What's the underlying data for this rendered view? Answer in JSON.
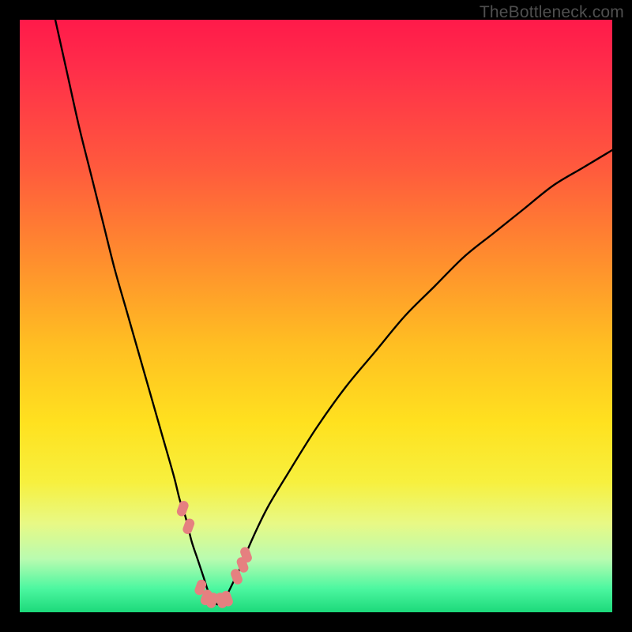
{
  "watermark": "TheBottleneck.com",
  "chart_data": {
    "type": "line",
    "title": "",
    "xlabel": "",
    "ylabel": "",
    "xlim": [
      0,
      100
    ],
    "ylim": [
      0,
      100
    ],
    "grid": false,
    "minimum_x": 33,
    "series": [
      {
        "name": "bottleneck-curve",
        "color": "#000000",
        "x": [
          6,
          8,
          10,
          12,
          14,
          16,
          18,
          20,
          22,
          24,
          26,
          27,
          28,
          29,
          30,
          31,
          32,
          33,
          34,
          35,
          36,
          37,
          38,
          40,
          42,
          45,
          50,
          55,
          60,
          65,
          70,
          75,
          80,
          85,
          90,
          95,
          100
        ],
        "values": [
          100,
          91,
          82,
          74,
          66,
          58,
          51,
          44,
          37,
          30,
          23,
          19,
          16,
          12,
          9,
          6,
          3,
          1.5,
          1.5,
          3,
          5,
          7,
          9.5,
          14,
          18,
          23,
          31,
          38,
          44,
          50,
          55,
          60,
          64,
          68,
          72,
          75,
          78
        ]
      }
    ],
    "markers": {
      "name": "highlight-points",
      "color": "#e58080",
      "x": [
        27.5,
        28.5,
        30.5,
        31.5,
        32.5,
        34.0,
        35.0,
        36.6,
        37.6,
        38.2
      ],
      "values": [
        17.5,
        14.5,
        4.2,
        2.5,
        2.0,
        2.0,
        2.3,
        6.0,
        8.0,
        9.7
      ]
    }
  }
}
